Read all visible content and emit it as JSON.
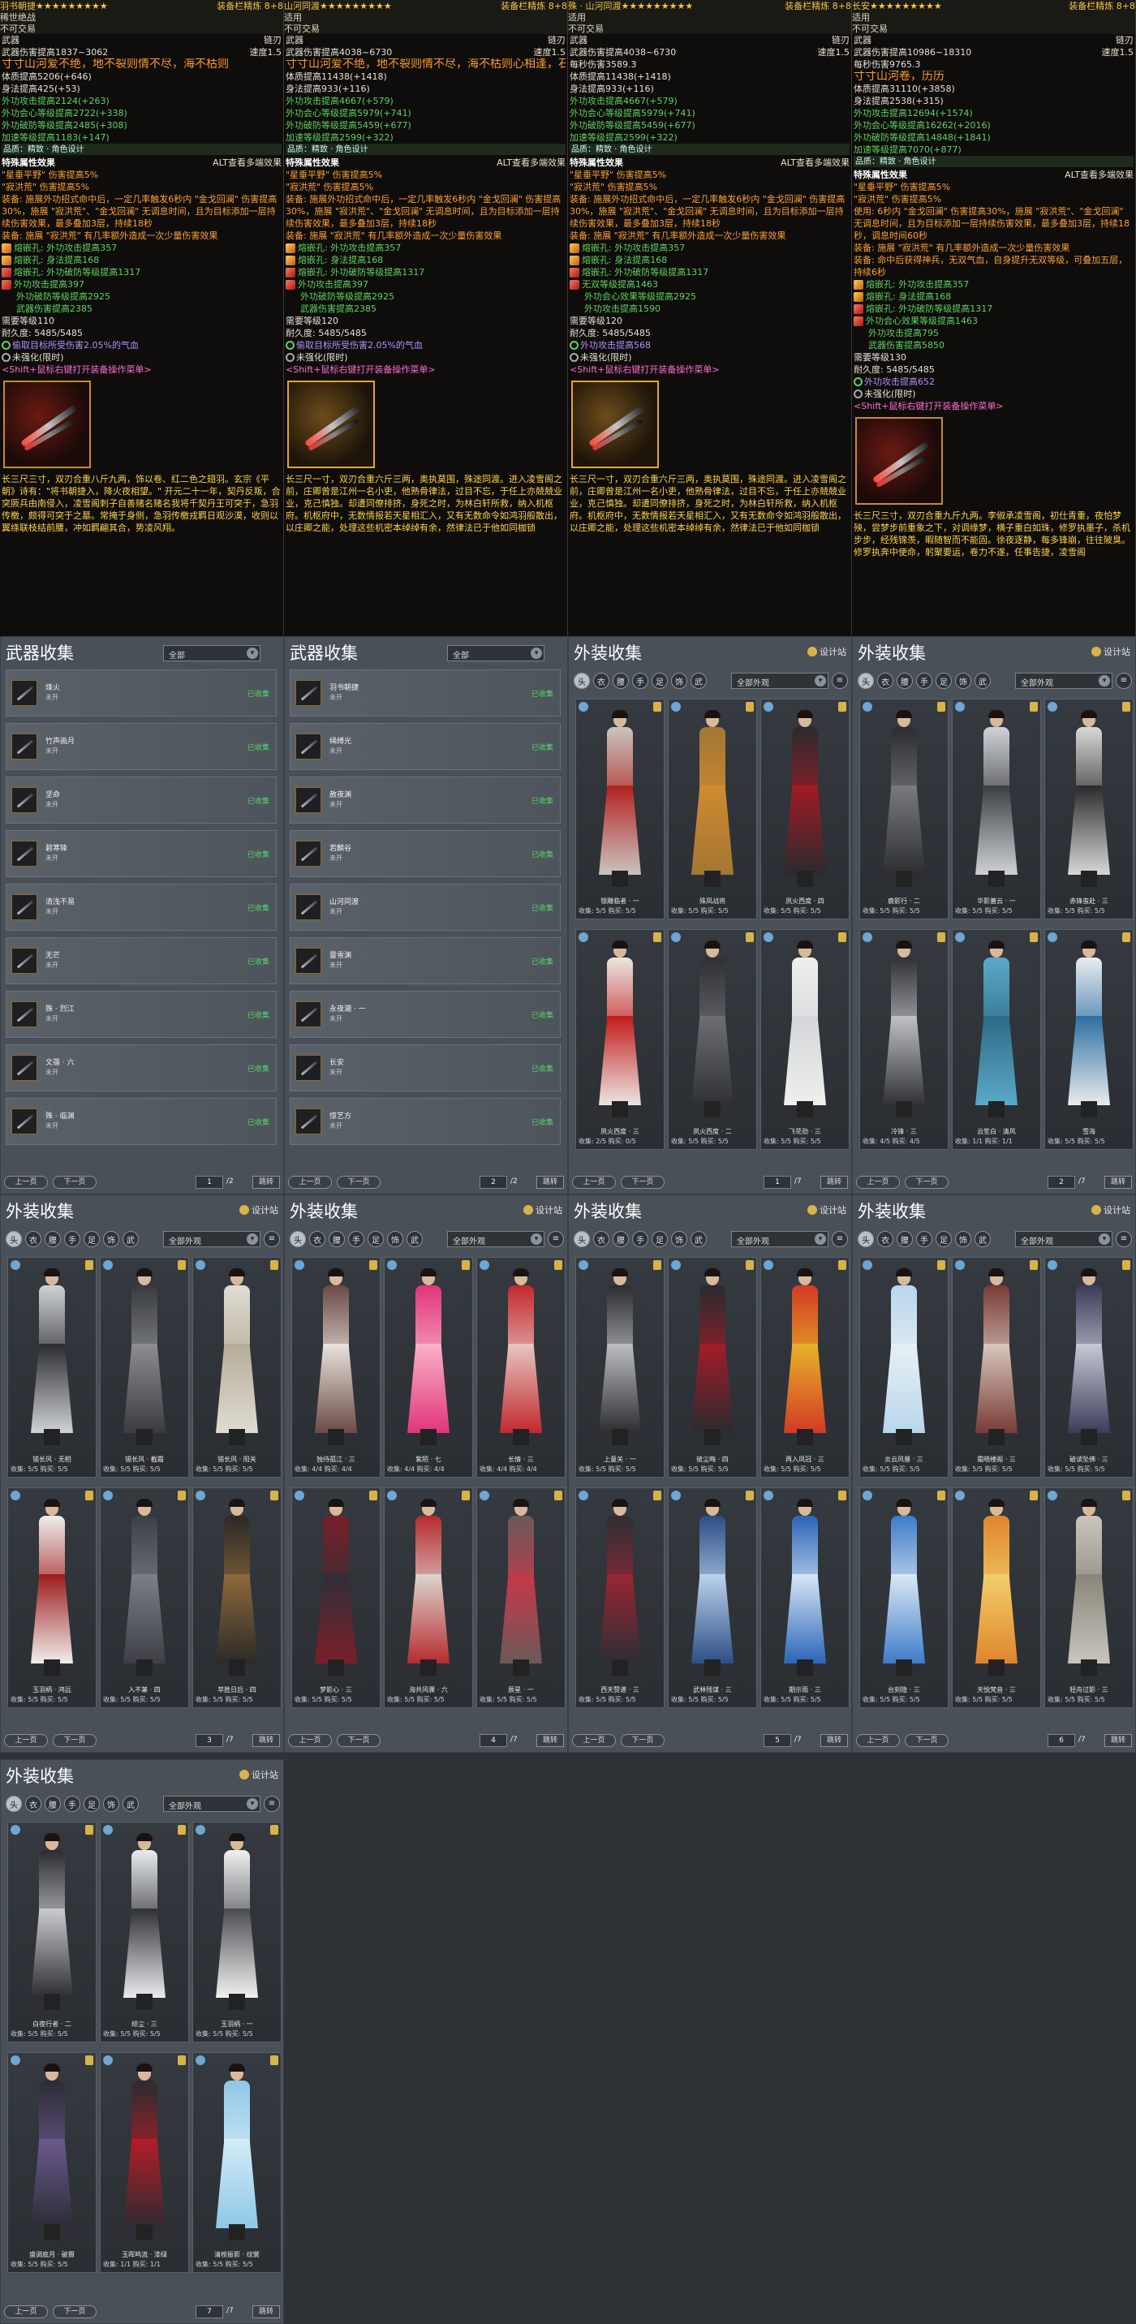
{
  "tooltips": [
    {
      "title": "羽书朝捷★★★★★★★★★",
      "title_right": "装备栏精炼 8+8",
      "sub1": "稀世绝战",
      "sub2": "不可交易",
      "type_l": "武器",
      "type_r": "链刃",
      "dmg_l": "武器伤害提高1837~3062",
      "dmg_r": "速度1.5",
      "poem": "寸寸山河爱不绝，地不裂则情不尽，海不枯则",
      "physique": "体质提高5206(+646)",
      "agility": "身法提高425(+53)",
      "attrs": [
        "外功攻击提高2124(+263)",
        "外功会心等级提高2722(+338)",
        "外功破防等级提高2485(+308)",
        "加速等级提高1183(+147)"
      ],
      "sep": "品质：精致 · 角色设计",
      "sec_l": "特殊属性效果",
      "sec_r": "ALT查看多端效果",
      "specials": [
        "\"星垂平野\" 伤害提高5%",
        "\"寂洪荒\" 伤害提高5%"
      ],
      "effect1": "装备: 施展外功招式命中后，一定几率触发6秒内 \"金戈回澜\" 伤害提高30%，施展 \"寂洪荒\"、\"金戈回澜\" 无调息时间，且为目标添加一层持续伤害效果，最多叠加3层，持续18秒",
      "effect2": "装备: 施展 \"寂洪荒\" 有几率额外造成一次少量伤害效果",
      "gems": [
        "熔嵌孔: 外功攻击提高357",
        "熔嵌孔: 身法提高168",
        "熔嵌孔: 外功破防等级提高1317"
      ],
      "gem_extra_head": "外功攻击提高397",
      "gem_extra": [
        "外功破防等级提高2925",
        "武器伤害提高2385"
      ],
      "req": "需要等级110",
      "dura": "耐久度: 5485/5485",
      "bind": "偷取目标所受伤害2.05%的气血",
      "unenh": "未强化(限时)",
      "hint": "<Shift+鼠标右键打开装备操作菜单>",
      "lore": "长三尺三寸，双刃合重八斤九两，饰以卷、红二色之翅羽。玄宗《平朝》诗有：\"将书朝捷入，降火夜相望。\" 开元二十一年，契丹反叛，合突厥兵由南侵入，凌雪阁刺子自善赌名赌名我将千契丹王可突于，急羽传檄，颇得可突于之墓。常掩于身侧，急羽传檄戎羁日观沙漠，收则以翼绦联枝结前腰，冲如羁翩其合，势凌风翔。"
    },
    {
      "title": "山河同渡★★★★★★★★★",
      "title_right": "装备栏精炼 8+8",
      "sub1": "适用",
      "sub2": "不可交易",
      "type_l": "武器",
      "type_r": "链刃",
      "dmg_l": "武器伤害提高4038~6730",
      "dmg_r": "速度1.5",
      "poem": "寸寸山河爱不绝，地不裂则情不尽，海不枯则心相逢，石不烂则",
      "physique": "体质提高11438(+1418)",
      "agility": "身法提高933(+116)",
      "attrs": [
        "外功攻击提高4667(+579)",
        "外功会心等级提高5979(+741)",
        "外功破防等级提高5459(+677)",
        "加速等级提高2599(+322)"
      ],
      "sep": "品质：精致 · 角色设计",
      "sec_l": "特殊属性效果",
      "sec_r": "ALT查看多端效果",
      "specials": [
        "\"星垂平野\" 伤害提高5%",
        "\"寂洪荒\" 伤害提高5%"
      ],
      "effect1": "装备: 施展外功招式命中后，一定几率触发6秒内 \"金戈回澜\" 伤害提高30%，施展 \"寂洪荒\"、\"金戈回澜\" 无调息时间，且为目标添加一层持续伤害效果，最多叠加3层，持续18秒",
      "effect2": "装备: 施展 \"寂洪荒\" 有几率额外造成一次少量伤害效果",
      "gems": [
        "熔嵌孔: 外功攻击提高357",
        "熔嵌孔: 身法提高168",
        "熔嵌孔: 外功破防等级提高1317"
      ],
      "gem_extra_head": "外功攻击提高397",
      "gem_extra": [
        "外功破防等级提高2925",
        "武器伤害提高2385"
      ],
      "req": "需要等级120",
      "dura": "耐久度: 5485/5485",
      "bind": "偷取目标所受伤害2.05%的气血",
      "unenh": "未强化(限时)",
      "hint": "<Shift+鼠标右键打开装备操作菜单>",
      "lore": "长三尺一寸，双刃合重六斤三两，奥执莫围，殊途同渡。进入凌雪阁之前，庄卿曾是江州一名小吏，他熟骨律法，过目不忘，于任上亦兢兢业业，克己慎独。却遭同僚排挤，身死之时，为林白轩所救，纳入机枢府。机枢府中，无数情报若天星相汇入，又有无数命令如鸿羽般散出，以庄卿之能，处理这些机密本绰绰有余，然律法已于他如同枷锁"
    },
    {
      "title": "殊 · 山河同渡★★★★★★★★★",
      "title_right": "装备栏精炼 8+8",
      "sub1": "适用",
      "sub2": "不可交易",
      "type_l": "武器",
      "type_r": "链刃",
      "dmg_l": "武器伤害提高4038~6730",
      "dmg_r": "速度1.5",
      "poem": "",
      "dps": "每秒伤害3589.3",
      "physique": "体质提高11438(+1418)",
      "agility": "身法提高933(+116)",
      "attrs": [
        "外功攻击提高4667(+579)",
        "外功会心等级提高5979(+741)",
        "外功破防等级提高5459(+677)",
        "加速等级提高2599(+322)"
      ],
      "sep": "品质：精致 · 角色设计",
      "sec_l": "特殊属性效果",
      "sec_r": "ALT查看多端效果",
      "specials": [
        "\"星垂平野\" 伤害提高5%",
        "\"寂洪荒\" 伤害提高5%"
      ],
      "effect1": "装备: 施展外功招式命中后，一定几率触发6秒内 \"金戈回澜\" 伤害提高30%，施展 \"寂洪荒\"、\"金戈回澜\" 无调息时间，且为目标添加一层持续伤害效果，最多叠加3层，持续18秒",
      "effect2": "装备: 施展 \"寂洪荒\" 有几率额外造成一次少量伤害效果",
      "gems": [
        "熔嵌孔: 外功攻击提高357",
        "熔嵌孔: 身法提高168",
        "熔嵌孔: 外功破防等级提高1317"
      ],
      "gem_extra_head": "无双等级提高1463",
      "gem_extra": [
        "外功会心效果等级提高2925",
        "外功攻击提高1590"
      ],
      "req": "需要等级120",
      "dura": "耐久度: 5485/5485",
      "bind": "外功攻击提高568",
      "unenh": "未强化(限时)",
      "hint": "<Shift+鼠标右键打开装备操作菜单>",
      "lore": "长三尺一寸，双刃合重六斤三两，奥执莫围，殊途同渡。进入凌雪阁之前，庄卿曾是江州一名小吏，他熟骨律法，过目不忘，于任上亦兢兢业业，克己慎独。却遭同僚排挤，身死之时，为林白轩所救，纳入机枢府。机枢府中，无数情报若天星相汇入，又有无数命令如鸿羽般散出，以庄卿之能，处理这些机密本绰绰有余，然律法已于他如同枷锁"
    },
    {
      "title": "长安★★★★★★★★★",
      "title_right": "装备栏精炼 8+8",
      "sub1": "适用",
      "sub2": "不可交易",
      "type_l": "武器",
      "type_r": "链刃",
      "dmg_l": "武器伤害提高10986~18310",
      "dmg_r": "速度1.5",
      "poem": "寸寸山河卷，历历",
      "dps": "每秒伤害9765.3",
      "physique": "体质提高31110(+3858)",
      "agility": "身法提高2538(+315)",
      "attrs": [
        "外功攻击提高12694(+1574)",
        "外功会心等级提高16262(+2016)",
        "外功破防等级提高14848(+1841)",
        "加速等级提高7070(+877)"
      ],
      "sep": "品质：精致 · 角色设计",
      "sec_l": "特殊属性效果",
      "sec_r": "ALT查看多端效果",
      "specials": [
        "\"星垂平野\" 伤害提高5%",
        "\"寂洪荒\" 伤害提高5%"
      ],
      "effect1": "使用: 6秒内 \"金戈回澜\" 伤害提高30%，施展 \"寂洪荒\"、\"金戈回澜\" 无调息时间，且为目标添加一层持续伤害效果，最多叠加3层，持续18秒，调息时间60秒",
      "effect2": "装备: 施展 \"寂洪荒\" 有几率额外造成一次少量伤害效果",
      "effect3": "装备: 命中后获得神兵，无双气血，自身提升无双等级，可叠加五层，持续6秒",
      "gems": [
        "熔嵌孔: 外功攻击提高357",
        "熔嵌孔: 身法提高168",
        "熔嵌孔: 外功破防等级提高1317"
      ],
      "gem_extra_head": "外功会心效果等级提高1463",
      "gem_extra": [
        "外功攻击提高795",
        "武器伤害提高5850"
      ],
      "req": "需要等级130",
      "dura": "耐久度: 5485/5485",
      "bind": "外功攻击提高652",
      "unenh": "未强化(限时)",
      "hint": "<Shift+鼠标右键打开装备操作菜单>",
      "lore": "长三尺三寸，双刃合重九斤九两。李俶承凌雪阁，初仕青重，夜怕梦殃，尝梦步前重象之下，对调缘梦，横子重白如珠，修罗执墨子，杀机步步，经残锦羡，暇随智而不能固。徐夜逐静，每多锋崩，往往陂臭。修罗执奔中使命，躬聚要运，卷力不遂，任事告捷，凌雪阁"
    }
  ],
  "weapon_panels": [
    {
      "title": "武器收集",
      "filter": "全部",
      "items": [
        {
          "name": "烽火",
          "status": "未开",
          "ok": "已收集"
        },
        {
          "name": "竹声画月",
          "status": "未开",
          "ok": "已收集"
        },
        {
          "name": "坚命",
          "status": "未开",
          "ok": "已收集"
        },
        {
          "name": "碧寒锋",
          "status": "未开",
          "ok": "已收集"
        },
        {
          "name": "清浅不易",
          "status": "未开",
          "ok": "已收集"
        },
        {
          "name": "无芒",
          "status": "未开",
          "ok": "已收集"
        },
        {
          "name": "殊 · 烈江",
          "status": "未开",
          "ok": "已收集"
        },
        {
          "name": "文蓓 · 六",
          "status": "未开",
          "ok": "已收集"
        },
        {
          "name": "殊 · 临渊",
          "status": "未开",
          "ok": "已收集"
        }
      ],
      "prev": "上一页",
      "next": "下一页",
      "page": "1",
      "total": "/2",
      "jump": "跳转"
    },
    {
      "title": "武器收集",
      "filter": "全部",
      "items": [
        {
          "name": "羽书朝捷",
          "status": "未开",
          "ok": "已收集"
        },
        {
          "name": "绳缚光",
          "status": "未开",
          "ok": "已收集"
        },
        {
          "name": "赦夜渊",
          "status": "未开",
          "ok": "已收集"
        },
        {
          "name": "若麟谷",
          "status": "未开",
          "ok": "已收集"
        },
        {
          "name": "山河同渡",
          "status": "未开",
          "ok": "已收集"
        },
        {
          "name": "曼雪渊",
          "status": "未开",
          "ok": "已收集"
        },
        {
          "name": "永夜潮 · 一",
          "status": "未开",
          "ok": "已收集"
        },
        {
          "name": "长安",
          "status": "未开",
          "ok": "已收集"
        },
        {
          "name": "惊艺方",
          "status": "未开",
          "ok": "已收集"
        }
      ],
      "prev": "上一页",
      "next": "下一页",
      "page": "2",
      "total": "/2",
      "jump": "跳转"
    }
  ],
  "outfit_panels": [
    {
      "title": "外装收集",
      "design": "设计站",
      "filter": "全部外观",
      "cards": [
        {
          "name": "银雕临者 · 一",
          "stats": "收集: 5/5  购买: 5/5",
          "palette": [
            "#c9c4bf",
            "#b1221f"
          ]
        },
        {
          "name": "殊凤战将",
          "stats": "收集: 5/5  购买: 5/5",
          "palette": [
            "#a27634",
            "#d08b2f"
          ]
        },
        {
          "name": "夙火西度 · 四",
          "stats": "收集: 5/5  购买: 5/5",
          "palette": [
            "#2a2a2e",
            "#a21a25"
          ]
        },
        {
          "name": "夙火西度 · 三",
          "stats": "收集: 2/5  购买: 0/5",
          "palette": [
            "#eae6e2",
            "#c21a1a"
          ]
        },
        {
          "name": "夙火西度 · 二",
          "stats": "收集: 5/5  购买: 5/5",
          "palette": [
            "#2f3034",
            "#6e6f74"
          ]
        },
        {
          "name": "飞花劲 · 三",
          "stats": "收集: 5/5  购买: 5/5",
          "palette": [
            "#efefed",
            "#d4d6d9"
          ]
        }
      ],
      "prev": "上一页",
      "next": "下一页",
      "page": "1",
      "total": "/7",
      "jump": "跳转"
    },
    {
      "title": "外装收集",
      "design": "设计站",
      "filter": "全部外观",
      "cards": [
        {
          "name": "鹿影行 · 二",
          "stats": "收集: 5/5  购买: 5/5",
          "palette": [
            "#2c2d31",
            "#7a7b80"
          ]
        },
        {
          "name": "华影蓋云 · 一",
          "stats": "收集: 5/5  购买: 5/5",
          "palette": [
            "#cfd2d6",
            "#3a3d42"
          ]
        },
        {
          "name": "赤锋蛮赴 · 三",
          "stats": "收集: 5/5  购买: 5/5",
          "palette": [
            "#d8d8d6",
            "#2a2a2c"
          ]
        },
        {
          "name": "冷锋 · 三",
          "stats": "收集: 4/5  购买: 4/5",
          "palette": [
            "#303236",
            "#bfc1c4"
          ]
        },
        {
          "name": "云笙白 · 清风",
          "stats": "收集: 1/1  购买: 1/1",
          "palette": [
            "#5aa9c9",
            "#2d6a84"
          ]
        },
        {
          "name": "雪海",
          "stats": "收集: 5/5  购买: 5/5",
          "palette": [
            "#e8ecef",
            "#2c6fa0"
          ]
        }
      ],
      "prev": "上一页",
      "next": "下一页",
      "page": "2",
      "total": "/7",
      "jump": "跳转"
    },
    {
      "title": "外装收集",
      "design": "设计站",
      "filter": "全部外观",
      "cards": [
        {
          "name": "锡长风 · 无相",
          "stats": "收集: 5/5  购买: 5/5",
          "palette": [
            "#cfd3d6",
            "#2a2b2f"
          ]
        },
        {
          "name": "锡长风 · 截霜",
          "stats": "收集: 5/5  购买: 5/5",
          "palette": [
            "#3a3b40",
            "#8c8e93"
          ]
        },
        {
          "name": "锡长风 · 阳关",
          "stats": "收集: 5/5  购买: 5/5",
          "palette": [
            "#e0dcd3",
            "#b5ab97"
          ]
        },
        {
          "name": "玉羽柄 · 鸿远",
          "stats": "收集: 5/5  购买: 5/5",
          "palette": [
            "#f0eeec",
            "#9c1b1b"
          ]
        },
        {
          "name": "入不兼 · 四",
          "stats": "收集: 5/5  购买: 5/5",
          "palette": [
            "#3c3f45",
            "#7c7f86"
          ]
        },
        {
          "name": "苹胜日后 · 四",
          "stats": "收集: 5/5  购买: 5/5",
          "palette": [
            "#2b2a28",
            "#8e6a3a"
          ]
        }
      ],
      "prev": "上一页",
      "next": "下一页",
      "page": "3",
      "total": "/7",
      "jump": "跳转"
    },
    {
      "title": "外装收集",
      "design": "设计站",
      "filter": "全部外观",
      "cards": [
        {
          "name": "独侍孤江 · 三",
          "stats": "收集: 4/4  购买: 4/4",
          "palette": [
            "#6b4a45",
            "#e9e4de"
          ]
        },
        {
          "name": "紫陌 · 七",
          "stats": "收集: 4/4  购买: 4/4",
          "palette": [
            "#e0357a",
            "#f9b2c8"
          ]
        },
        {
          "name": "长情 · 三",
          "stats": "收集: 4/4  购买: 4/4",
          "palette": [
            "#c2282e",
            "#e7c6c2"
          ]
        },
        {
          "name": "梦影心 · 三",
          "stats": "收集: 5/5  购买: 5/5",
          "palette": [
            "#7a1f2a",
            "#2f2f38"
          ]
        },
        {
          "name": "海共风骤 · 六",
          "stats": "收集: 5/5  购买: 5/5",
          "palette": [
            "#b72b2f",
            "#dcd6cf"
          ]
        },
        {
          "name": "辰星 · 一",
          "stats": "收集: 5/5  购买: 5/5",
          "palette": [
            "#6b5a58",
            "#c9364a"
          ]
        }
      ],
      "prev": "上一页",
      "next": "下一页",
      "page": "4",
      "total": "/7",
      "jump": "跳转"
    },
    {
      "title": "外装收集",
      "design": "设计站",
      "filter": "全部外观",
      "cards": [
        {
          "name": "上童关 · 一",
          "stats": "收集: 5/5  购买: 5/5",
          "palette": [
            "#2b2d31",
            "#bdbec2"
          ]
        },
        {
          "name": "彼尘晦 · 四",
          "stats": "收集: 5/5  购买: 5/5",
          "palette": [
            "#2a2b2f",
            "#a21c28"
          ]
        },
        {
          "name": "再入凤冠 · 三",
          "stats": "收集: 5/5  购买: 5/5",
          "palette": [
            "#d33a24",
            "#e7b32a"
          ]
        },
        {
          "name": "西天赞谱 · 三",
          "stats": "收集: 5/5  购买: 5/5",
          "palette": [
            "#2d2e34",
            "#9a2633"
          ]
        },
        {
          "name": "武林残谋 · 三",
          "stats": "收集: 5/5  购买: 5/5",
          "palette": [
            "#2d4f86",
            "#bcd2ee"
          ]
        },
        {
          "name": "期示雨 · 三",
          "stats": "收集: 5/5  购买: 5/5",
          "palette": [
            "#2b65b8",
            "#d9e7f6"
          ]
        }
      ],
      "prev": "上一页",
      "next": "下一页",
      "page": "5",
      "total": "/7",
      "jump": "跳转"
    },
    {
      "title": "外装收集",
      "design": "设计站",
      "filter": "全部外观",
      "cards": [
        {
          "name": "炎云风暴 · 三",
          "stats": "收集: 5/5  购买: 5/5",
          "palette": [
            "#b8d6ec",
            "#e8f0f6"
          ]
        },
        {
          "name": "霜晓楼阁 · 三",
          "stats": "收集: 5/5  购买: 5/5",
          "palette": [
            "#7a3b36",
            "#d7c7bc"
          ]
        },
        {
          "name": "破读坠佛 · 三",
          "stats": "收集: 5/5  购买: 5/5",
          "palette": [
            "#3b3c58",
            "#c7c9d6"
          ]
        },
        {
          "name": "台刻隐 · 三",
          "stats": "收集: 5/5  购买: 5/5",
          "palette": [
            "#3e7cc9",
            "#dce8f4"
          ]
        },
        {
          "name": "天悦梵音 · 三",
          "stats": "收集: 5/5  购买: 5/5",
          "palette": [
            "#e0852c",
            "#f1d06a"
          ]
        },
        {
          "name": "轻舟过影 · 三",
          "stats": "收集: 5/5  购买: 5/5",
          "palette": [
            "#c9c5bd",
            "#8a8479"
          ]
        }
      ],
      "prev": "上一页",
      "next": "下一页",
      "page": "6",
      "total": "/7",
      "jump": "跳转"
    },
    {
      "title": "外装收集",
      "design": "设计站",
      "filter": "全部外观",
      "cards": [
        {
          "name": "白夜行者 · 二",
          "stats": "收集: 5/5  购买: 5/5",
          "palette": [
            "#2c2d32",
            "#c9ccd0"
          ]
        },
        {
          "name": "绯尘 · 三",
          "stats": "收集: 5/5  购买: 5/5",
          "palette": [
            "#e9ebee",
            "#2f3036"
          ]
        },
        {
          "name": "玉羽柄 · 一",
          "stats": "收集: 5/5  购买: 5/5",
          "palette": [
            "#f1f1ef",
            "#4a4b52"
          ]
        },
        {
          "name": "盛调庭月 · 破摄",
          "stats": "收集: 5/5  购买: 5/5",
          "palette": [
            "#2c2c36",
            "#6b5a8e"
          ]
        },
        {
          "name": "玉晖鸣流 · 漆绿",
          "stats": "收集: 1/1  购买: 1/1",
          "palette": [
            "#2b2c30",
            "#b51c28"
          ]
        },
        {
          "name": "清桉振影 · 纹裳",
          "stats": "收集: 5/5  购买: 5/5",
          "palette": [
            "#8fc7e6",
            "#d4ecf7"
          ]
        }
      ],
      "prev": "上一页",
      "next": "下一页",
      "page": "7",
      "total": "/7",
      "jump": "跳转"
    }
  ],
  "filter_icons": [
    "头",
    "衣",
    "腰",
    "手",
    "足",
    "饰",
    "武"
  ]
}
